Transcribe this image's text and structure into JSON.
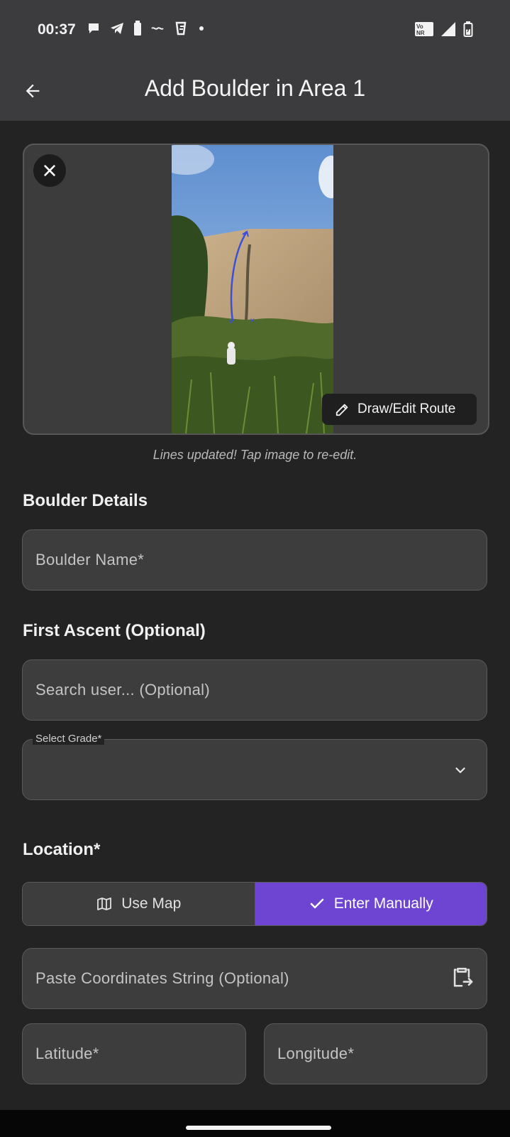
{
  "status_bar": {
    "time": "00:37",
    "icons_left": [
      "chat-bubble-icon",
      "telegram-icon",
      "battery-full-icon",
      "notification-icon",
      "flipkart-icon",
      "dot-icon"
    ],
    "network_badge": "Vo NR",
    "icons_right": [
      "vonr-icon",
      "signal-icon",
      "battery-charging-icon"
    ]
  },
  "app_bar": {
    "back_icon": "arrow-back-icon",
    "title": "Add Boulder in Area 1"
  },
  "image_card": {
    "close_icon": "close-icon",
    "draw_icon": "pencil-icon",
    "draw_label": "Draw/Edit Route",
    "hint": "Lines updated! Tap image to re-edit."
  },
  "boulder_details": {
    "heading": "Boulder Details",
    "name_placeholder": "Boulder Name*"
  },
  "first_ascent": {
    "heading": "First Ascent (Optional)",
    "search_placeholder": "Search user... (Optional)"
  },
  "grade": {
    "label": "Select Grade*",
    "value": "",
    "dropdown_icon": "chevron-down-icon"
  },
  "location": {
    "heading": "Location*",
    "map_icon": "map-icon",
    "map_label": "Use Map",
    "manual_icon": "check-icon",
    "manual_label": "Enter Manually",
    "selected": "Enter Manually",
    "paste_placeholder": "Paste Coordinates String (Optional)",
    "paste_icon": "clipboard-paste-icon",
    "latitude_placeholder": "Latitude*",
    "longitude_placeholder": "Longitude*"
  },
  "colors": {
    "background": "#232323",
    "bar": "#3c3c3e",
    "field": "#3d3d3d",
    "accent": "#6d45d2"
  }
}
